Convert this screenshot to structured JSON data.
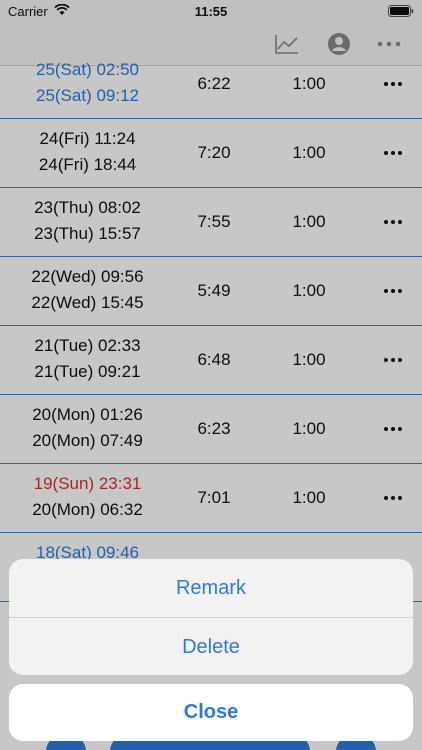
{
  "status_bar": {
    "carrier": "Carrier",
    "time": "11:55"
  },
  "nav": {
    "chart_icon": "chart-line-icon",
    "profile_icon": "person-circle-icon",
    "more_icon": "ellipsis-icon"
  },
  "rows": [
    {
      "start": "25(Sat) 02:50",
      "end": "25(Sat) 09:12",
      "duration": "6:22",
      "break": "1:00",
      "start_color": "blue",
      "end_color": "blue"
    },
    {
      "start": "24(Fri) 11:24",
      "end": "24(Fri) 18:44",
      "duration": "7:20",
      "break": "1:00",
      "start_color": "default",
      "end_color": "default"
    },
    {
      "start": "23(Thu) 08:02",
      "end": "23(Thu) 15:57",
      "duration": "7:55",
      "break": "1:00",
      "start_color": "default",
      "end_color": "default"
    },
    {
      "start": "22(Wed) 09:56",
      "end": "22(Wed) 15:45",
      "duration": "5:49",
      "break": "1:00",
      "start_color": "default",
      "end_color": "default"
    },
    {
      "start": "21(Tue) 02:33",
      "end": "21(Tue) 09:21",
      "duration": "6:48",
      "break": "1:00",
      "start_color": "default",
      "end_color": "default"
    },
    {
      "start": "20(Mon) 01:26",
      "end": "20(Mon) 07:49",
      "duration": "6:23",
      "break": "1:00",
      "start_color": "default",
      "end_color": "default"
    },
    {
      "start": "19(Sun) 23:31",
      "end": "20(Mon) 06:32",
      "duration": "7:01",
      "break": "1:00",
      "start_color": "red",
      "end_color": "default"
    },
    {
      "start": "18(Sat) 09:46",
      "end": "",
      "duration": "",
      "break": "",
      "start_color": "blue",
      "end_color": "default"
    }
  ],
  "action_sheet": {
    "remark": "Remark",
    "delete": "Delete",
    "close": "Close"
  },
  "colors": {
    "accent": "#2f7ad9",
    "weekend_red": "#d8322f",
    "row_divider": "#4a7fc0"
  }
}
